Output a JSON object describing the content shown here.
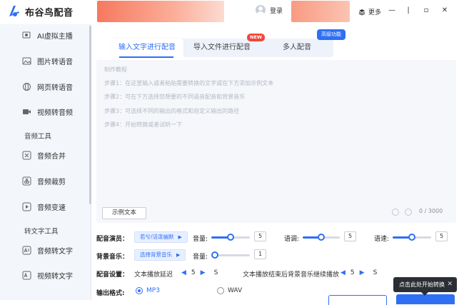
{
  "app": {
    "title": "布谷鸟配音"
  },
  "header": {
    "login_label": "登录",
    "more_label": "更多"
  },
  "sidebar": {
    "items_top": [
      {
        "label": "AI虚拟主播",
        "icon": "avatar-icon"
      },
      {
        "label": "图片转语音",
        "icon": "image-icon"
      },
      {
        "label": "网页转语音",
        "icon": "web-icon"
      },
      {
        "label": "视频转音频",
        "icon": "video-icon"
      }
    ],
    "section_audio": "音频工具",
    "items_audio": [
      {
        "label": "音频合并",
        "icon": "merge-icon"
      },
      {
        "label": "音频裁剪",
        "icon": "scissors-icon"
      },
      {
        "label": "音频变速",
        "icon": "speed-icon"
      }
    ],
    "section_text": "转文字工具",
    "items_text": [
      {
        "label": "音频转文字",
        "icon": "audio-text-icon"
      },
      {
        "label": "视频转文字",
        "icon": "video-text-icon"
      }
    ]
  },
  "tabs": [
    {
      "label": "输入文字进行配音",
      "active": true
    },
    {
      "label": "导入文件进行配音",
      "badge": "NEW"
    },
    {
      "label": "多人配音",
      "badge": "高级功能"
    }
  ],
  "editor": {
    "guide_title": "制作教程",
    "steps": [
      "步骤1：在这里输入或者粘贴需要转换的文字或在下方添加示例文本",
      "步骤2：可在下方选择您想要的不同语音配音和背景音乐",
      "步骤3：可选择不同的输出的格式和自定义输出的路径",
      "步骤4：开始转换或者试听一下"
    ],
    "sample_button": "示例文本",
    "counter": "0 / 3000"
  },
  "settings": {
    "voice_label": "配音演员：",
    "voice_value": "若兮/活泼幽默",
    "volume_label": "音量:",
    "volume_value": "5",
    "volume_level": 0.5,
    "pitch_label": "语调:",
    "pitch_value": "5",
    "pitch_level": 0.5,
    "speed_label": "语速:",
    "speed_value": "5",
    "speed_level": 0.5,
    "bgm_label": "背景音乐：",
    "bgm_value": "选择背景音乐",
    "bgm_volume_label": "音量:",
    "bgm_volume_value": "1",
    "bgm_volume_level": 0.1,
    "config_label": "配音设置：",
    "delay_label": "文本播放延迟",
    "delay_value": "5",
    "delay_unit": "S",
    "after_label": "文本播放结束后背景音乐继续播放",
    "after_value": "5",
    "after_unit": "S",
    "format_label": "输出格式:",
    "format_options": [
      "MP3",
      "WAV"
    ],
    "format_selected": "MP3"
  },
  "tooltip": {
    "text": "点击此处开始转换",
    "close": "✕"
  },
  "colors": {
    "accent": "#2f6ff4",
    "badge_new": "#f1473b"
  }
}
